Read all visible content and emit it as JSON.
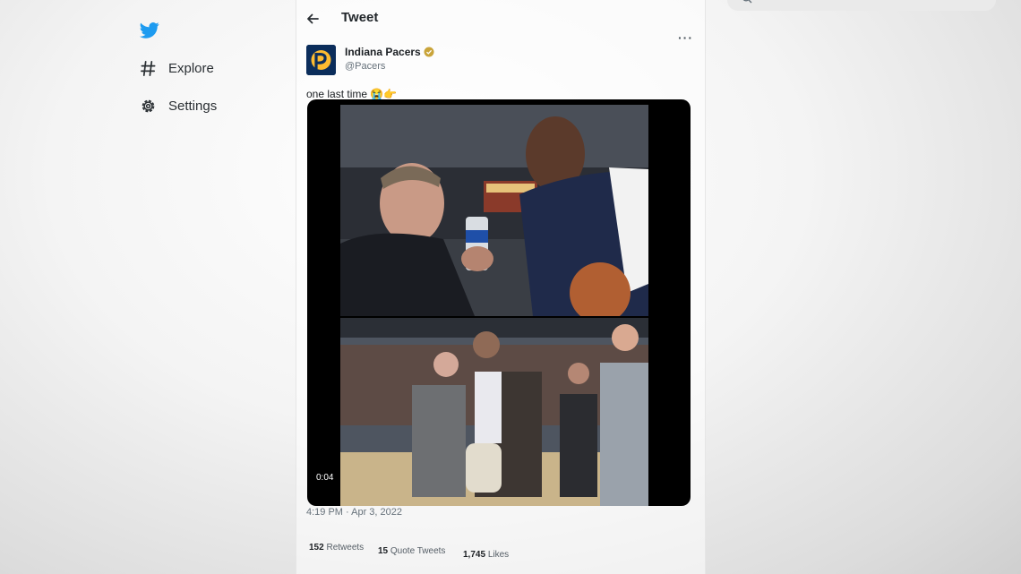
{
  "nav": {
    "items": [
      {
        "label": "Explore",
        "icon": "hashtag-icon"
      },
      {
        "label": "Settings",
        "icon": "gear-icon"
      }
    ]
  },
  "header": {
    "title": "Tweet"
  },
  "tweet": {
    "author": {
      "name": "Indiana Pacers",
      "handle": "@Pacers",
      "verified": true
    },
    "text": "one last time 😭👉",
    "media": {
      "type": "video",
      "duration": "0:04"
    },
    "timestamp": "4:19 PM · Apr 3, 2022",
    "stats": {
      "retweets_count": "152",
      "retweets_label": "Retweets",
      "quotes_count": "15",
      "quotes_label": "Quote Tweets",
      "likes_count": "1,745",
      "likes_label": "Likes"
    }
  },
  "colors": {
    "brand": "#1d9bf0",
    "pacers_navy": "#0b2d5b",
    "pacers_gold": "#fdbb30"
  }
}
